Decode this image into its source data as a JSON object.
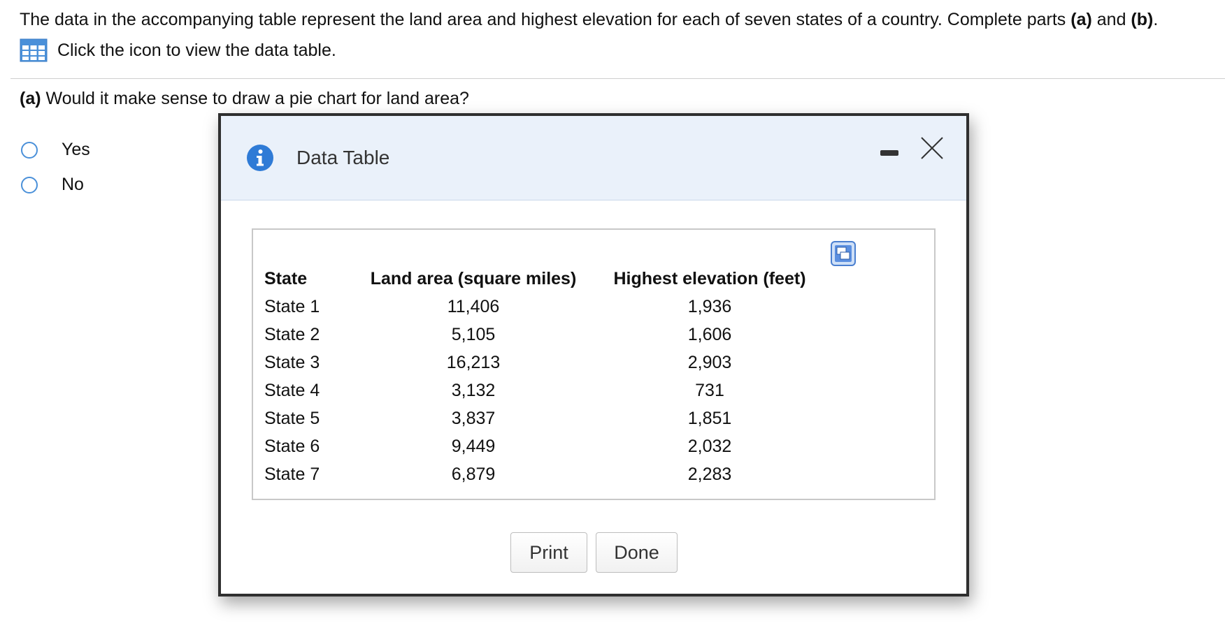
{
  "question": {
    "intro_text": "The data in the accompanying table represent the land area and highest elevation for each of seven states of a country. Complete parts ",
    "part_a_ref": "(a)",
    "and_text": " and ",
    "part_b_ref": "(b)",
    "period": ".",
    "view_table_text": "Click the icon to view the data table.",
    "part_a_label": "(a)",
    "part_a_text": " Would it make sense to draw a pie chart for land area?",
    "options": [
      {
        "label": "Yes",
        "selected": false
      },
      {
        "label": "No",
        "selected": false
      }
    ]
  },
  "modal": {
    "title": "Data Table",
    "headers": [
      "State",
      "Land area (square miles)",
      "Highest elevation (feet)"
    ],
    "rows": [
      [
        "State 1",
        "11,406",
        "1,936"
      ],
      [
        "State 2",
        "5,105",
        "1,606"
      ],
      [
        "State 3",
        "16,213",
        "2,903"
      ],
      [
        "State 4",
        "3,132",
        "731"
      ],
      [
        "State 5",
        "3,837",
        "1,851"
      ],
      [
        "State 6",
        "9,449",
        "2,032"
      ],
      [
        "State 7",
        "6,879",
        "2,283"
      ]
    ],
    "print_label": "Print",
    "done_label": "Done"
  },
  "icons": {
    "table": "table-grid-icon",
    "info": "info-icon",
    "minimize": "minimize-icon",
    "close": "close-icon",
    "copy": "copy-to-spreadsheet-icon"
  },
  "colors": {
    "accent": "#4a90d9",
    "info_blue": "#2f7bd6",
    "header_bg": "#eaf1fa"
  }
}
